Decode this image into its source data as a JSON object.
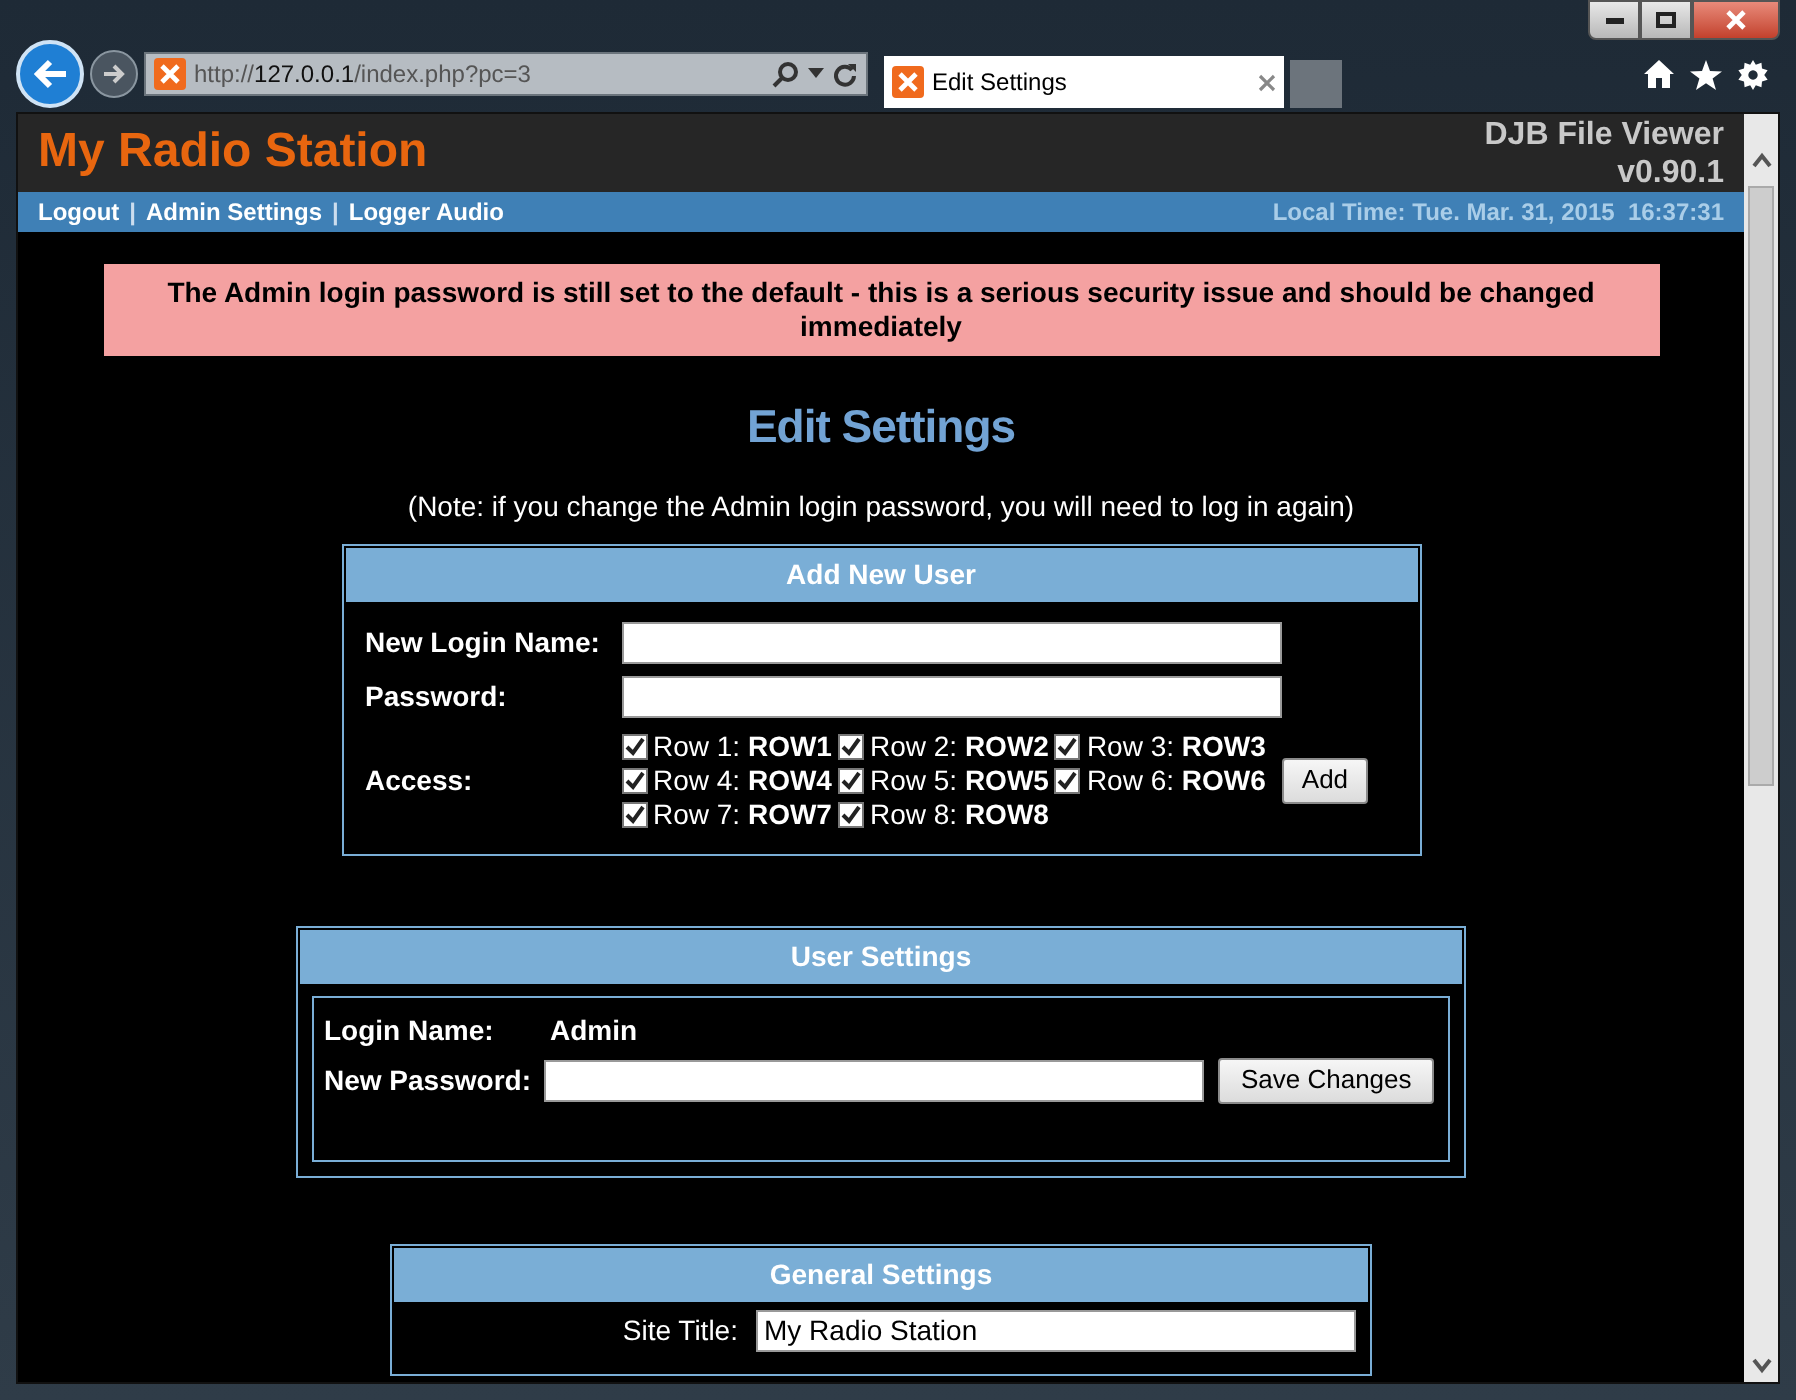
{
  "browser": {
    "address": {
      "scheme": "http://",
      "host": "127.0.0.1",
      "path": "/index.php?pc=3"
    },
    "tab_title": "Edit Settings"
  },
  "header": {
    "site_title": "My Radio Station",
    "app_name": "DJB File Viewer",
    "version": "v0.90.1"
  },
  "nav": {
    "links": [
      "Logout",
      "Admin Settings",
      "Logger Audio"
    ],
    "separator": "|",
    "local_time": "Local Time: Tue. Mar. 31, 2015  16:37:31"
  },
  "alert": "The Admin login password is still set to the default - this is a serious security issue and should be changed immediately",
  "page_title": "Edit Settings",
  "note": "(Note: if you change the Admin login password, you will need to log in again)",
  "add_user": {
    "title": "Add New User",
    "login_label": "New Login Name:",
    "password_label": "Password:",
    "access_label": "Access:",
    "access": [
      {
        "label": "Row 1:",
        "value": "ROW1",
        "checked": true
      },
      {
        "label": "Row 2:",
        "value": "ROW2",
        "checked": true
      },
      {
        "label": "Row 3:",
        "value": "ROW3",
        "checked": true
      },
      {
        "label": "Row 4:",
        "value": "ROW4",
        "checked": true
      },
      {
        "label": "Row 5:",
        "value": "ROW5",
        "checked": true
      },
      {
        "label": "Row 6:",
        "value": "ROW6",
        "checked": true
      },
      {
        "label": "Row 7:",
        "value": "ROW7",
        "checked": true
      },
      {
        "label": "Row 8:",
        "value": "ROW8",
        "checked": true
      }
    ],
    "add_button": "Add"
  },
  "user_settings": {
    "title": "User Settings",
    "login_label": "Login Name:",
    "login_value": "Admin",
    "password_label": "New Password:",
    "save_button": "Save Changes"
  },
  "general_settings": {
    "title": "General Settings",
    "site_title_label": "Site Title:",
    "site_title_value": "My Radio Station"
  }
}
